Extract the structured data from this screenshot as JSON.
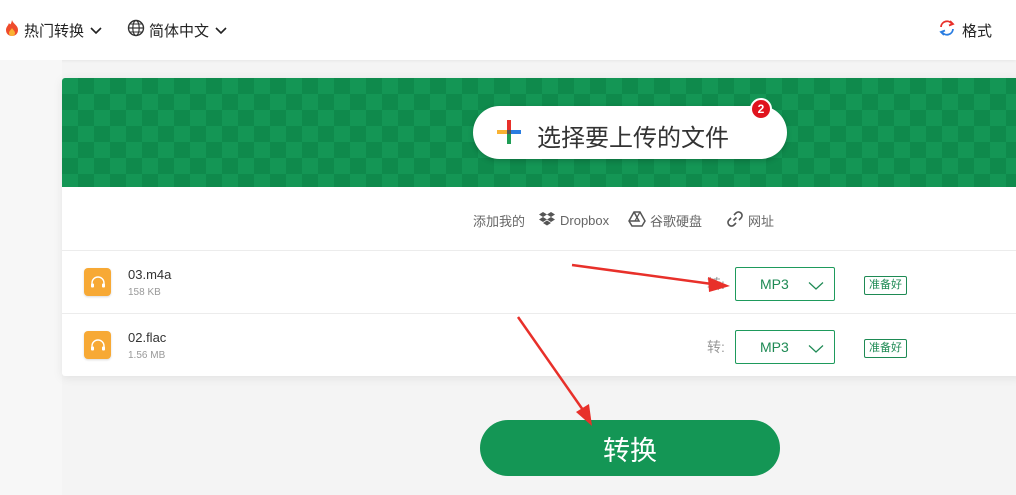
{
  "topbar": {
    "hot_convert_label": "热门转换",
    "language_label": "简体中文",
    "format_label": "格式"
  },
  "upload": {
    "button_label": "选择要上传的文件",
    "badge_count": "2"
  },
  "sources": {
    "prefix": "添加我的",
    "dropbox": "Dropbox",
    "google_drive": "谷歌硬盘",
    "url": "网址"
  },
  "files": [
    {
      "name": "03.m4a",
      "size": "158 KB",
      "to_label": "转:",
      "format": "MP3",
      "status": "准备好"
    },
    {
      "name": "02.flac",
      "size": "1.56 MB",
      "to_label": "转:",
      "format": "MP3",
      "status": "准备好"
    }
  ],
  "convert_button": "转换",
  "colors": {
    "brand_green": "#149655",
    "badge_red": "#e0141e",
    "file_icon_orange": "#f7a935",
    "arrow_red": "#e8302a"
  }
}
